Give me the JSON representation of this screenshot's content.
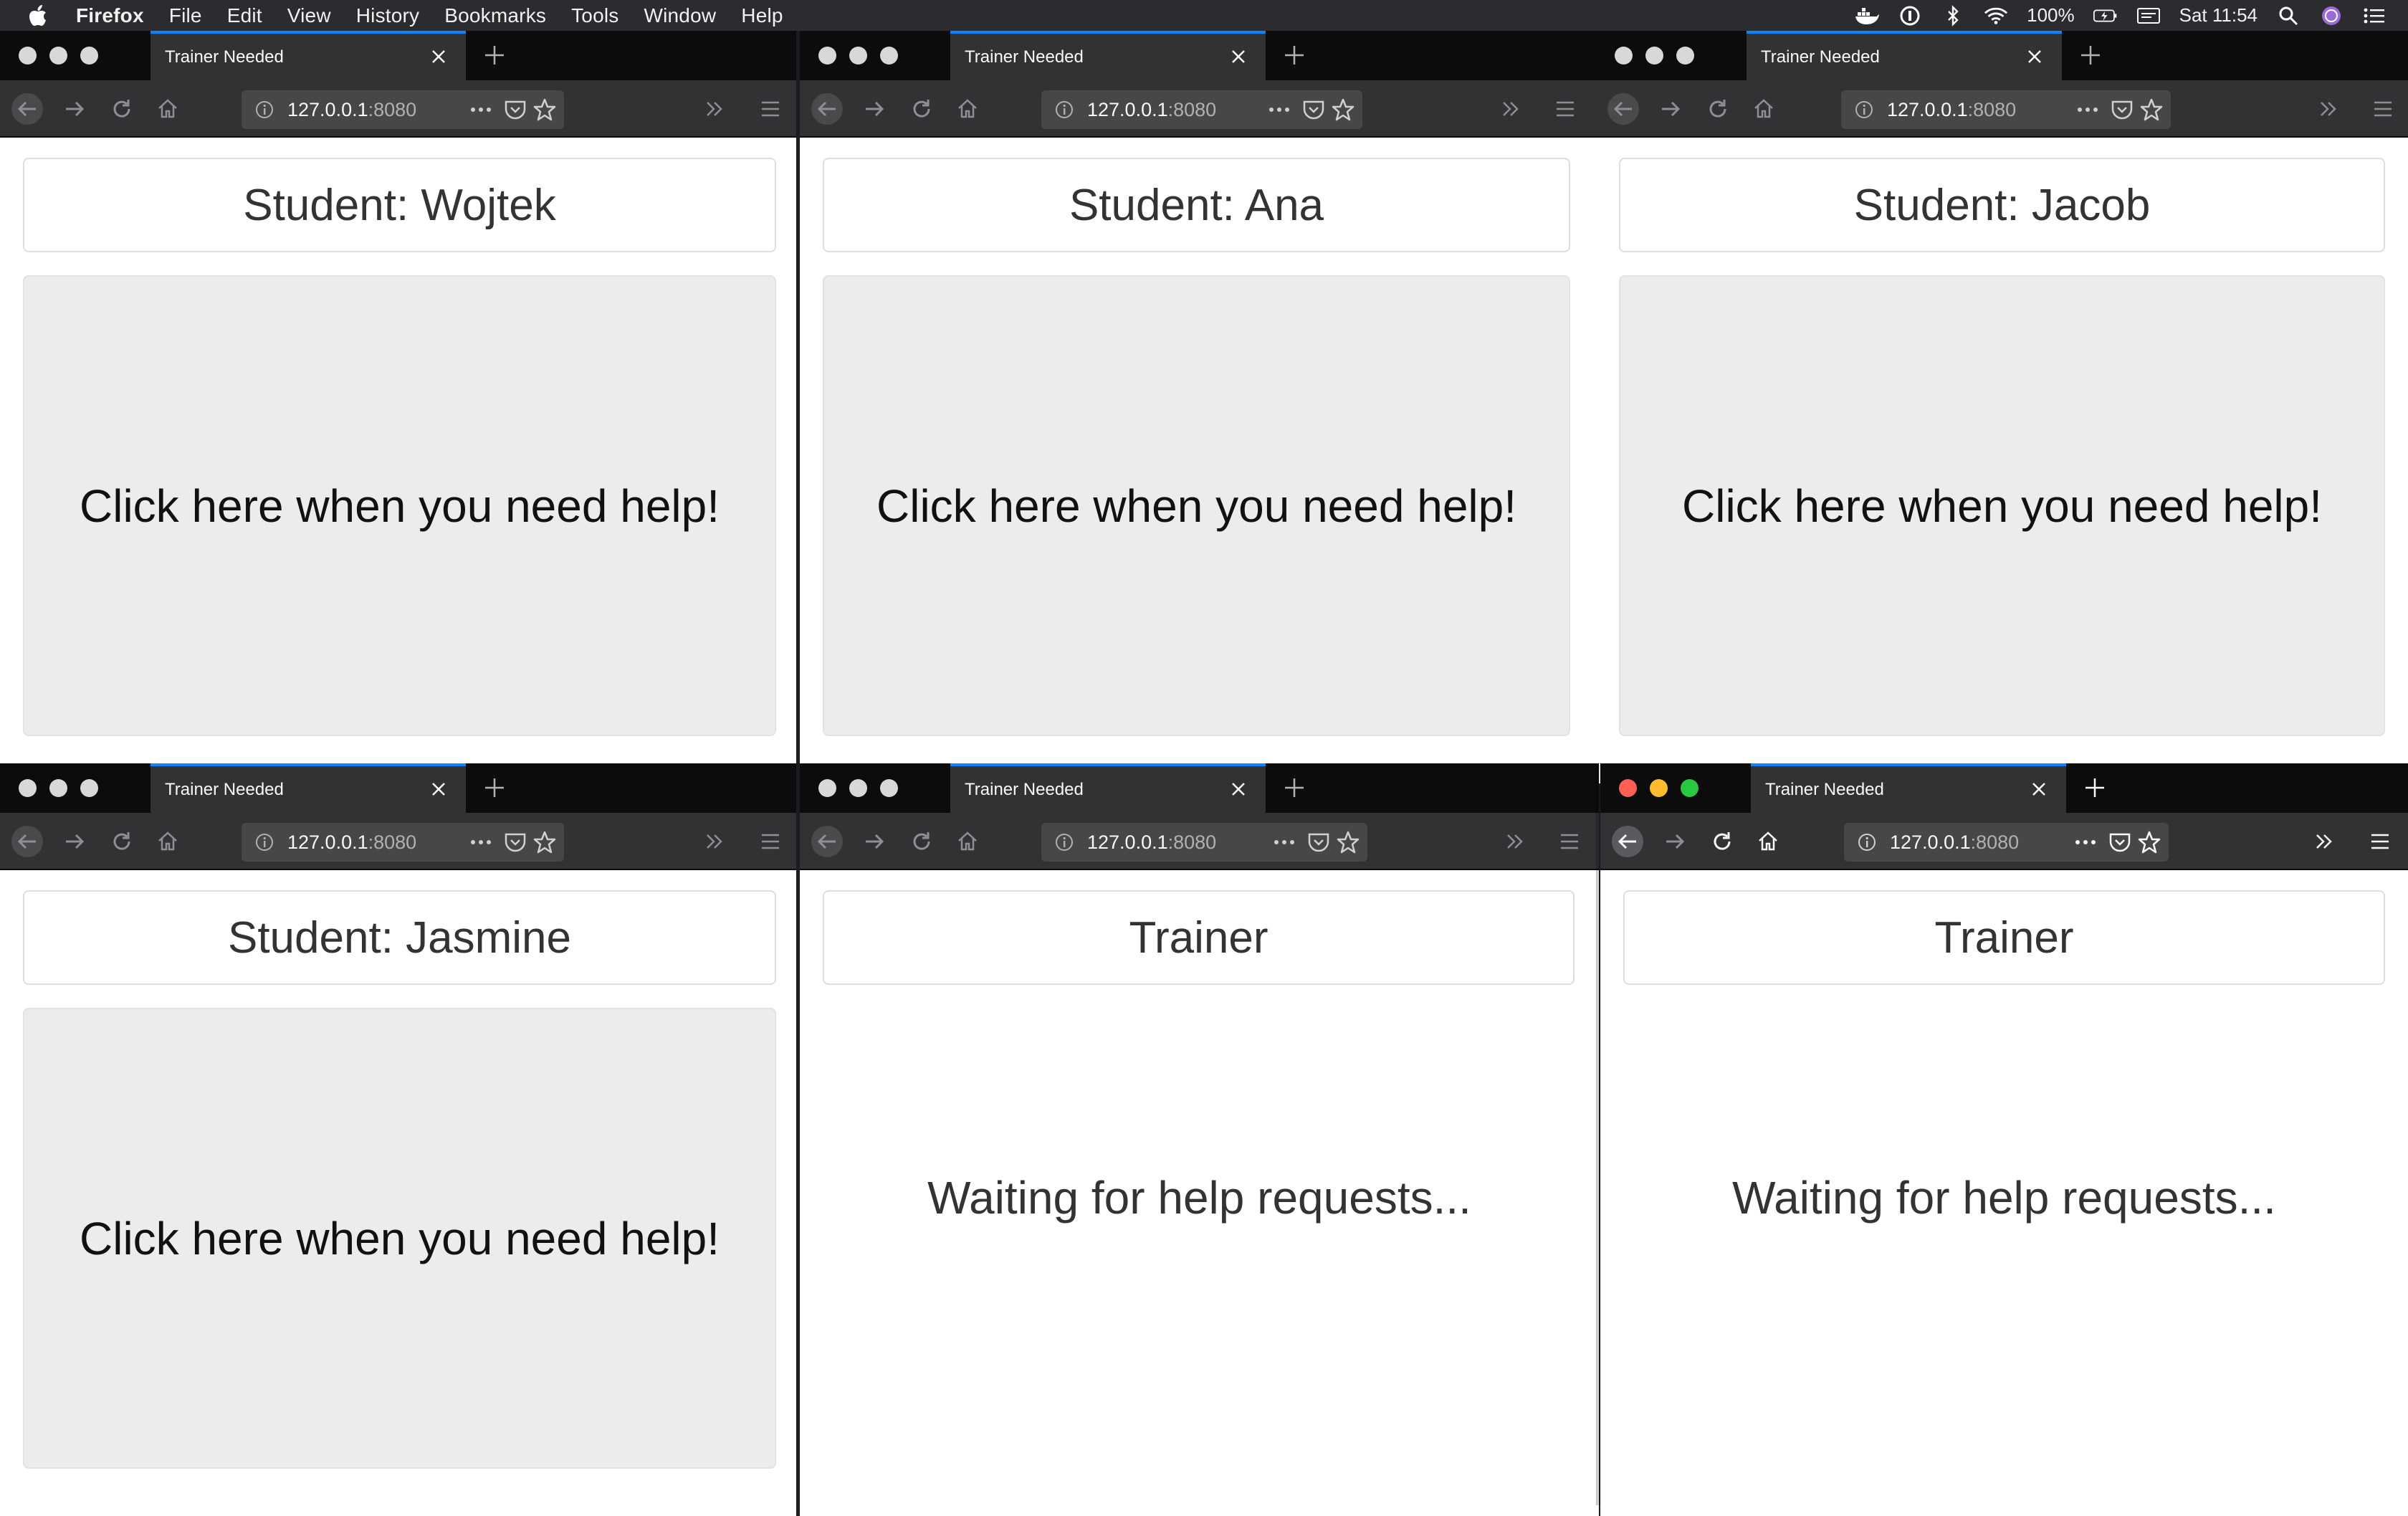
{
  "menubar": {
    "app_name": "Firefox",
    "items": [
      "File",
      "Edit",
      "View",
      "History",
      "Bookmarks",
      "Tools",
      "Window",
      "Help"
    ],
    "battery": "100%",
    "clock": "Sat 11:54"
  },
  "windows": [
    {
      "tab_title": "Trainer Needed",
      "url_host": "127.0.0.1",
      "url_port": ":8080",
      "header": "Student: Wojtek",
      "body_text": "Click here when you need help!",
      "active": false
    },
    {
      "tab_title": "Trainer Needed",
      "url_host": "127.0.0.1",
      "url_port": ":8080",
      "header": "Student: Ana",
      "body_text": "Click here when you need help!",
      "active": false
    },
    {
      "tab_title": "Trainer Needed",
      "url_host": "127.0.0.1",
      "url_port": ":8080",
      "header": "Student: Jacob",
      "body_text": "Click here when you need help!",
      "active": false
    },
    {
      "tab_title": "Trainer Needed",
      "url_host": "127.0.0.1",
      "url_port": ":8080",
      "header": "Student: Jasmine",
      "body_text": "Click here when you need help!",
      "active": false
    },
    {
      "tab_title": "Trainer Needed",
      "url_host": "127.0.0.1",
      "url_port": ":8080",
      "header": "Trainer",
      "body_text": "Waiting for help requests...",
      "active": false
    },
    {
      "tab_title": "Trainer Needed",
      "url_host": "127.0.0.1",
      "url_port": ":8080",
      "header": "Trainer",
      "body_text": "Waiting for help requests...",
      "active": true
    }
  ]
}
